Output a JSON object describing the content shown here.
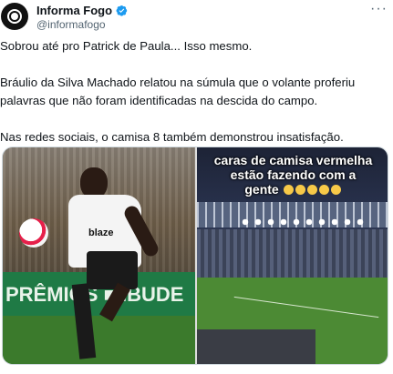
{
  "header": {
    "display_name": "Informa Fogo",
    "handle": "@informafogo",
    "verified_color": "#1d9bf0",
    "more_label": "···"
  },
  "tweet": {
    "paragraphs": [
      "Sobrou até pro Patrick de Paula... Isso mesmo.",
      "Bráulio da Silva Machado relatou na súmula que o volante proferiu palavras que não foram identificadas na descida do campo.",
      "Nas redes sociais, o camisa 8 também demonstrou insatisfação."
    ]
  },
  "media": {
    "left": {
      "banner_text": "PRÊMIOS ■ IBUDE",
      "sponsor_text": "blaze"
    },
    "right": {
      "caption_line1": "caras de camisa vermelha",
      "caption_line2": "estão fazendo com a",
      "caption_line3": "gente"
    }
  }
}
